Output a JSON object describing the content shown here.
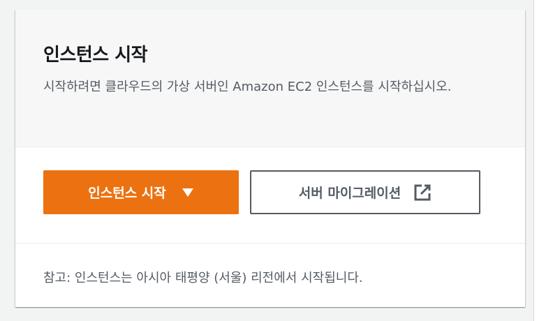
{
  "card": {
    "title": "인스턴스 시작",
    "description": "시작하려면 클라우드의 가상 서버인 Amazon EC2 인스턴스를 시작하십시오.",
    "launch_button_label": "인스턴스 시작",
    "launch_button_icon": "caret-down-icon",
    "migrate_button_label": "서버 마이그레이션",
    "migrate_button_icon": "external-link-icon",
    "footer_note": "참고: 인스턴스는 아시아 태평양 (서울) 리전에서 시작됩니다."
  },
  "colors": {
    "primary": "#ec7211",
    "text_dark": "#16191f",
    "text_muted": "#545b64",
    "header_bg": "#f7f7f7"
  }
}
